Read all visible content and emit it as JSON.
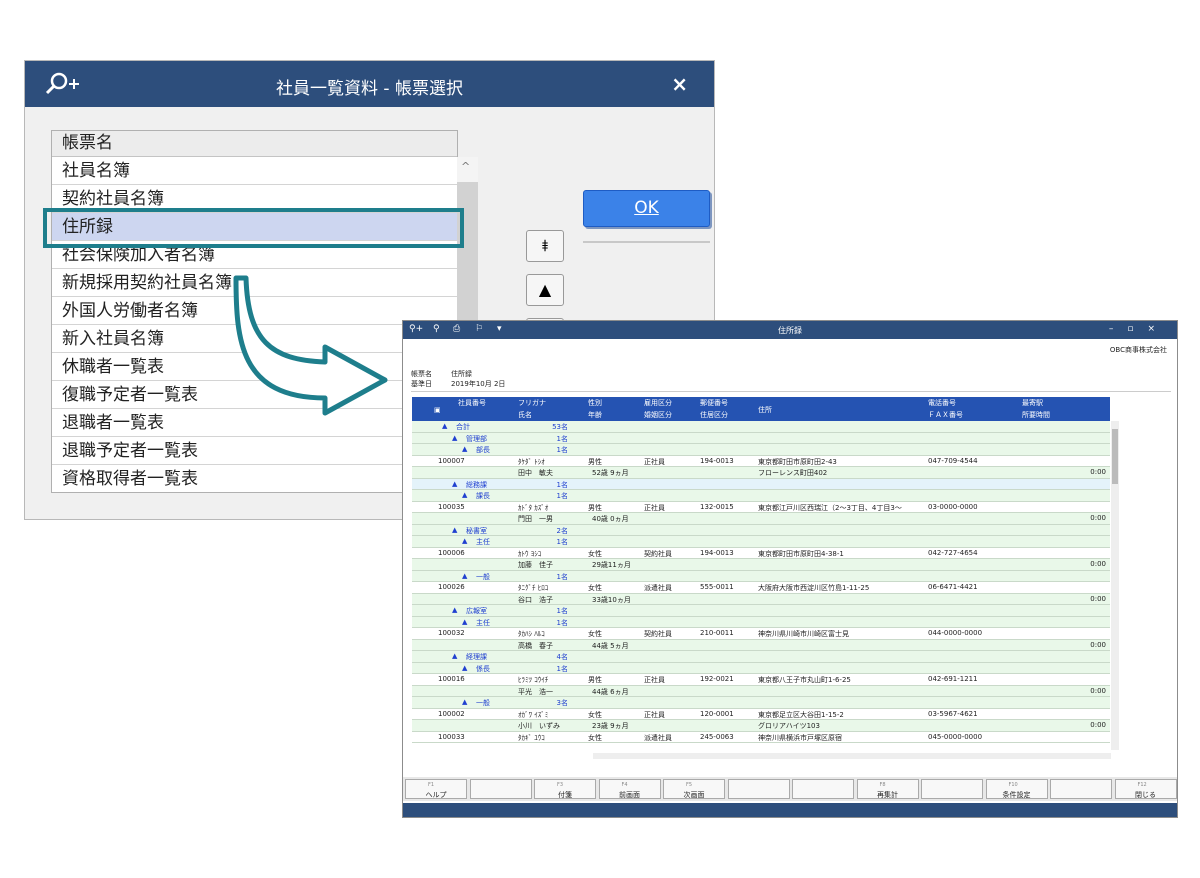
{
  "dialog": {
    "title": "社員一覧資料 - 帳票選択",
    "close": "×",
    "ok": "OK",
    "list_header": "帳票名",
    "items": [
      "社員名簿",
      "契約社員名簿",
      "住所録",
      "社会保険加入者名簿",
      "新規採用契約社員名簿",
      "外国人労働者名簿",
      "新入社員名簿",
      "休職者一覧表",
      "復職予定者一覧表",
      "退職者一覧表",
      "退職予定者一覧表",
      "資格取得者一覧表"
    ],
    "selected": "住所録",
    "move_top": "⯒",
    "move_up": "▲",
    "scroll_up": "^"
  },
  "report": {
    "title": "住所録",
    "company": "OBC商事株式会社",
    "label_name": "帳票名",
    "value_name": "住所録",
    "label_date": "基準日",
    "value_date": "2019年10月 2日",
    "columns": {
      "a1": "社員番号",
      "b1": "フリガナ",
      "b2": "氏名",
      "c1": "性別",
      "c2": "年齢",
      "d1": "雇用区分",
      "d2": "婚姻区分",
      "e1": "郵便番号",
      "e2": "住居区分",
      "f1": "住所",
      "g1": "電話番号",
      "g2": "ＦＡＸ番号",
      "h1": "最寄駅",
      "h2": "所要時間"
    },
    "rows": [
      [
        "g",
        "▲",
        "合計",
        "53名"
      ],
      [
        "g",
        "▲",
        "管理部",
        "1名"
      ],
      [
        "g",
        "▲",
        "部長",
        "1名"
      ],
      [
        "d",
        "100007",
        "ﾀｹﾀﾞ ﾄｼｵ",
        "男性",
        "正社員",
        "194-0013",
        "東京都町田市原町田2-43",
        "047-709-4544"
      ],
      [
        "e",
        "田中　敏夫",
        "52歳 9ヵ月",
        "",
        "",
        "フローレンス町田402",
        "0:00"
      ],
      [
        "g2",
        "▲",
        "総務課",
        "1名"
      ],
      [
        "g",
        "▲",
        "課長",
        "1名"
      ],
      [
        "d",
        "100035",
        "ｶﾄﾞﾀ ｶｽﾞｵ",
        "男性",
        "正社員",
        "132-0015",
        "東京都江戸川区西瑞江（2～3丁目、4丁目3～",
        "03-0000-0000"
      ],
      [
        "e",
        "門田　一男",
        "40歳 0ヵ月",
        "",
        "",
        "",
        "0:00"
      ],
      [
        "g",
        "▲",
        "秘書室",
        "2名"
      ],
      [
        "g",
        "▲",
        "主任",
        "1名"
      ],
      [
        "d",
        "100006",
        "ｶﾄｳ ﾖｼｺ",
        "女性",
        "契約社員",
        "194-0013",
        "東京都町田市原町田4-38-1",
        "042-727-4654"
      ],
      [
        "e",
        "加藤　佳子",
        "29歳11ヵ月",
        "",
        "",
        "",
        "0:00"
      ],
      [
        "g",
        "▲",
        "一般",
        "1名"
      ],
      [
        "d",
        "100026",
        "ﾀﾆｸﾞﾁ ﾋﾛｺ",
        "女性",
        "派遣社員",
        "555-0011",
        "大阪府大阪市西淀川区竹島1-11-25",
        "06-6471-4421"
      ],
      [
        "e",
        "谷口　浩子",
        "33歳10ヵ月",
        "",
        "",
        "",
        "0:00"
      ],
      [
        "g",
        "▲",
        "広報室",
        "1名"
      ],
      [
        "g",
        "▲",
        "主任",
        "1名"
      ],
      [
        "d",
        "100032",
        "ﾀｶﾊｼ ﾊﾙｺ",
        "女性",
        "契約社員",
        "210-0011",
        "神奈川県川崎市川崎区富士見",
        "044-0000-0000"
      ],
      [
        "e",
        "高橋　春子",
        "44歳 5ヵ月",
        "",
        "",
        "",
        "0:00"
      ],
      [
        "g",
        "▲",
        "経理課",
        "4名"
      ],
      [
        "g",
        "▲",
        "係長",
        "1名"
      ],
      [
        "d",
        "100016",
        "ﾋﾗﾐﾂ ｺｳｲﾁ",
        "男性",
        "正社員",
        "192-0021",
        "東京都八王子市丸山町1-6-25",
        "042-691-1211"
      ],
      [
        "e",
        "平光　浩一",
        "44歳 6ヵ月",
        "",
        "",
        "",
        "0:00"
      ],
      [
        "g",
        "▲",
        "一般",
        "3名"
      ],
      [
        "d",
        "100002",
        "ｵｶﾞﾜ ｲｽﾞﾐ",
        "女性",
        "正社員",
        "120-0001",
        "東京都足立区大谷田1-15-2",
        "03-5967-4621"
      ],
      [
        "e",
        "小川　いずみ",
        "23歳 9ヵ月",
        "",
        "",
        "グロリアハイツ103",
        "0:00"
      ],
      [
        "d",
        "100033",
        "ﾀｶｷﾞ ﾕｳｺ",
        "女性",
        "派遣社員",
        "245-0063",
        "神奈川県横浜市戸塚区原宿",
        "045-0000-0000"
      ]
    ],
    "fkeys": [
      [
        "F1",
        "ヘルプ"
      ],
      [
        "",
        ""
      ],
      [
        "F3",
        "付箋"
      ],
      [
        "F4",
        "前画面"
      ],
      [
        "F5",
        "次画面"
      ],
      [
        "",
        ""
      ],
      [
        "",
        ""
      ],
      [
        "F8",
        "再集計"
      ],
      [
        "",
        ""
      ],
      [
        "F10",
        "条件設定"
      ],
      [
        "",
        ""
      ],
      [
        "F12",
        "閉じる"
      ]
    ]
  },
  "colors": {
    "title_bar": "#2d4e7c",
    "selection_border": "#1e7e8c",
    "ok": "#3b82e8",
    "header": "#2553b2",
    "group_text": "#2040d0"
  }
}
